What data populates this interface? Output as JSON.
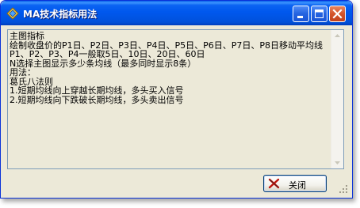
{
  "window": {
    "title": "MA技术指标用法"
  },
  "content": {
    "lines": [
      "主图指标",
      "绘制收盘价的P1日、P2日、P3日、P4日、P5日、P6日、P7日、P8日移动平均线",
      "P1、P2、P3、P4一般取5日、10日、20日、60日",
      "N选择主图显示多少条均线（最多同时显示8条）",
      "用法：",
      "葛氏八法则",
      "1.短期均线向上穿越长期均线，多头买入信号",
      "2.短期均线向下跌破长期均线，多头卖出信号"
    ]
  },
  "buttons": {
    "close_label": "关闭"
  },
  "icons": {
    "app": "app-icon",
    "minimize": "minimize-icon",
    "maximize": "maximize-icon",
    "close": "close-icon",
    "button_x": "red-x-icon"
  },
  "colors": {
    "titlebar": "#0054e3",
    "window_bg": "#ece9d8",
    "close_red": "#c2421c",
    "field_border": "#7f9db9"
  }
}
